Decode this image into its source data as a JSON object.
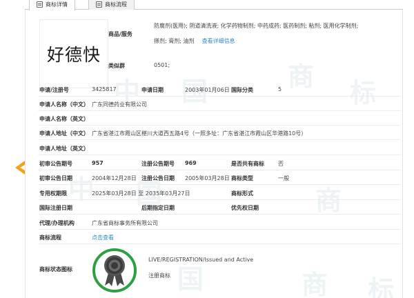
{
  "tabs": [
    {
      "label": "商标详情",
      "active": true
    },
    {
      "label": "商标流程",
      "active": false
    }
  ],
  "trademark": {
    "logo_text": "好德快",
    "goods_label": "商品/服务",
    "goods_line1": "防腐剂(医用); 阴道清洗液; 化学药物制剂; 中药成药; 医药制剂; 粘剂; 医用化学制剂;",
    "goods_line2": "搽剂; 膏剂; 油剂",
    "goods_more": "查看详细信息",
    "similar_group_label": "类似群",
    "similar_group_value": "0501;"
  },
  "rows": {
    "reg_no_label": "申请/注册号",
    "reg_no_value": "3425817",
    "app_date_label": "申请日期",
    "app_date_value": "2003年01月06日",
    "intl_class_label": "国际分类",
    "intl_class_value": "5",
    "applicant_cn_label": "申请人名称（中文）",
    "applicant_cn_value": "广东同德药业有限公司",
    "applicant_en_label": "申请人名称（英文）",
    "address_cn_label": "申请人地址（中文）",
    "address_cn_value": "广东省湛江市霞山区椹川大道西五路4号（一照多址：广东省湛江市霞山区华港路10号）",
    "address_en_label": "申请人地址（英文）",
    "prelim_no_label": "初审公告期号",
    "prelim_no_value": "957",
    "reg_pub_no_label": "注册公告期号",
    "reg_pub_no_value": "969",
    "shared_label": "是否共有商标",
    "shared_value": "否",
    "prelim_date_label": "初审公告日期",
    "prelim_date_value": "2004年12月28日",
    "reg_pub_date_label": "注册公告日期",
    "reg_pub_date_value": "2005年03月28日",
    "type_label": "商标类型",
    "type_value": "一般",
    "term_label": "专用权期限",
    "term_value": "2025年03月28日 至 2035年03月27日",
    "form_label": "商标形式",
    "intl_reg_date_label": "国际注册日期",
    "later_date_label": "后期指定日期",
    "priority_label": "优先权日期",
    "agent_label": "代理/办理机构",
    "agent_value": "广东省商标事务所有限公司",
    "flow_label": "商标流程",
    "flow_link": "点击查看",
    "status_label": "商标状态图标",
    "status_line1": "LIVE/REGISTRATION/Issued and Active",
    "status_line2": "注册商标"
  },
  "colors": {
    "accent_orange": "#f5a21b",
    "link_blue": "#2f8ac9",
    "seal_green": "#2f9f47"
  },
  "icons": [
    "document-icon",
    "flow-icon",
    "back-arrow-icon",
    "registered-seal-icon"
  ]
}
